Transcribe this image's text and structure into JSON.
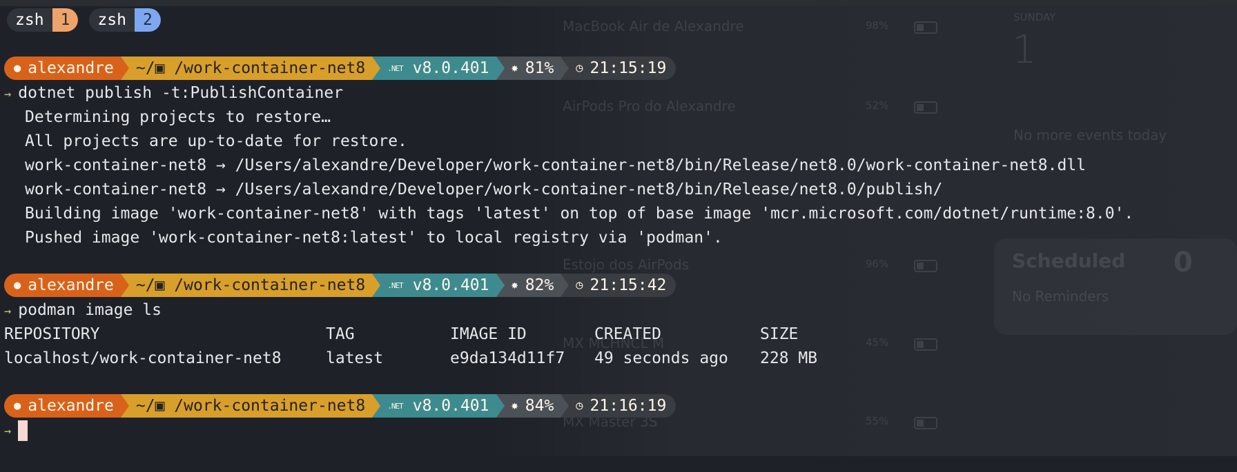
{
  "background_widgets": {
    "devices": [
      {
        "name": "MacBook Air de Alexandre",
        "percent": "98%"
      },
      {
        "name": "AirPods Pro do Alexandre",
        "percent": "52%"
      },
      {
        "name": "Estojo dos AirPods",
        "percent": "96%"
      },
      {
        "name": "MX MCHNCL M",
        "percent": "45%"
      },
      {
        "name": "MX Master 3S",
        "percent": "55%"
      }
    ],
    "calendar_day": "SUNDAY",
    "calendar_date": "1",
    "calendar_note": "No more events today",
    "reminders_title": "Scheduled",
    "reminders_count": "0",
    "reminders_note": "No Reminders"
  },
  "tabs": [
    {
      "name": "zsh",
      "number": "1"
    },
    {
      "name": "zsh",
      "number": "2"
    }
  ],
  "prompts": [
    {
      "user": "alexandre",
      "path": "~/▣ /work-container-net8",
      "dotnet_badge": ".NET",
      "dotnet": "v8.0.401",
      "battery": "81%",
      "time": "21:15:19"
    },
    {
      "user": "alexandre",
      "path": "~/▣ /work-container-net8",
      "dotnet_badge": ".NET",
      "dotnet": "v8.0.401",
      "battery": "82%",
      "time": "21:15:42"
    },
    {
      "user": "alexandre",
      "path": "~/▣ /work-container-net8",
      "dotnet_badge": ".NET",
      "dotnet": "v8.0.401",
      "battery": "84%",
      "time": "21:16:19"
    }
  ],
  "prompt_symbol": "→",
  "commands": [
    "dotnet publish -t:PublishContainer",
    "podman image ls"
  ],
  "output1": [
    "Determining projects to restore…",
    "All projects are up-to-date for restore.",
    "work-container-net8 → /Users/alexandre/Developer/work-container-net8/bin/Release/net8.0/work-container-net8.dll",
    "work-container-net8 → /Users/alexandre/Developer/work-container-net8/bin/Release/net8.0/publish/",
    "Building image 'work-container-net8' with tags 'latest' on top of base image 'mcr.microsoft.com/dotnet/runtime:8.0'.",
    "Pushed image 'work-container-net8:latest' to local registry via 'podman'."
  ],
  "image_table": {
    "headers": [
      "REPOSITORY",
      "TAG",
      "IMAGE ID",
      "CREATED",
      "SIZE"
    ],
    "rows": [
      [
        "localhost/work-container-net8",
        "latest",
        "e9da134d11f7",
        "49 seconds ago",
        "228 MB"
      ]
    ]
  },
  "colors": {
    "user": "#d8621a",
    "path": "#d99f2b",
    "dotnet": "#3d8b8f",
    "battery": "#4c5157",
    "time": "#393c40",
    "tab1": "#f0a26b",
    "tab2": "#7ea7f2",
    "cursor": "#f5d9d2"
  }
}
